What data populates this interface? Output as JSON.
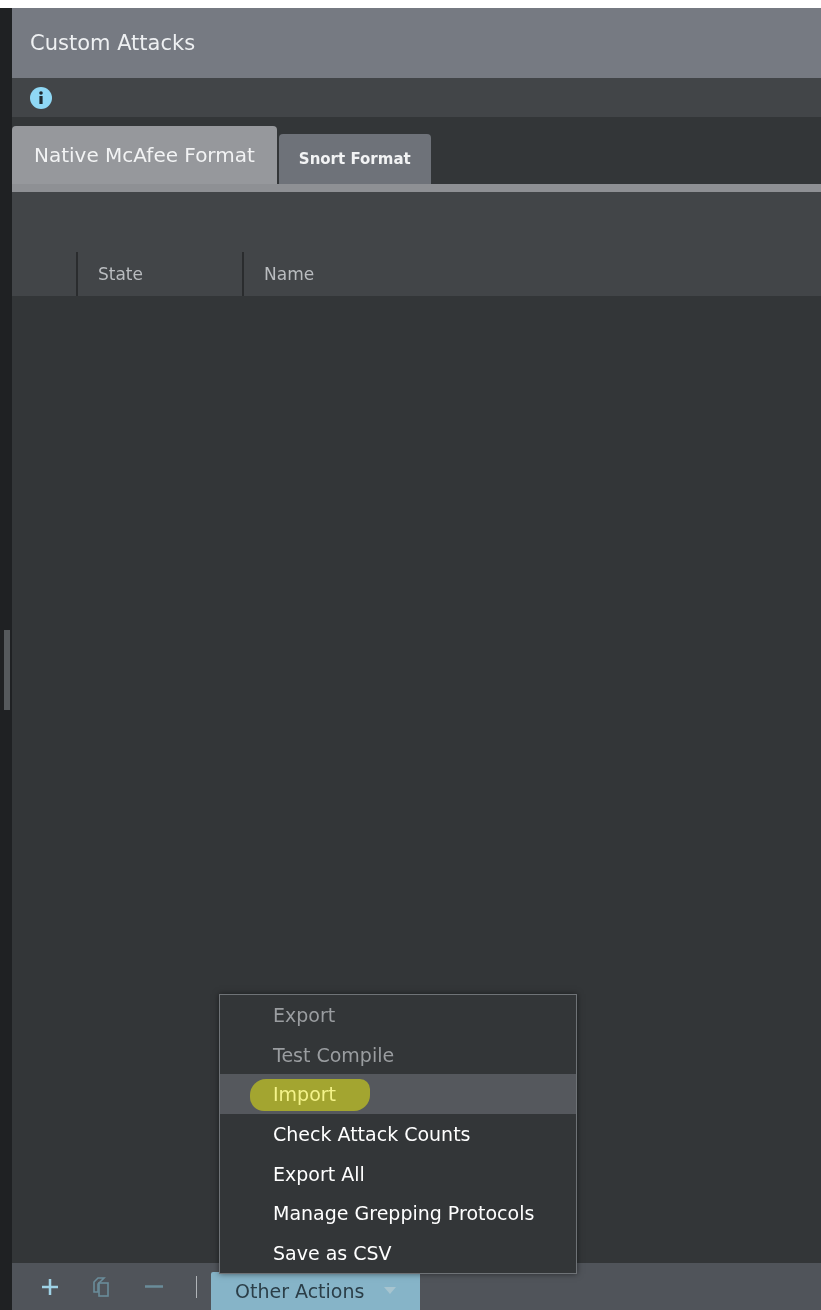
{
  "panel": {
    "title": "Custom Attacks"
  },
  "tabs": [
    {
      "label": "Native McAfee Format",
      "selected": true
    },
    {
      "label": "Snort Format",
      "selected": false
    }
  ],
  "table": {
    "columns": [
      "State",
      "Name"
    ]
  },
  "menu": {
    "items": [
      {
        "label": "Export",
        "disabled": true,
        "selected": false,
        "marked": false
      },
      {
        "label": "Test Compile",
        "disabled": true,
        "selected": false,
        "marked": false
      },
      {
        "label": "Import",
        "disabled": false,
        "selected": true,
        "marked": true
      },
      {
        "label": "Check Attack Counts",
        "disabled": false,
        "selected": false,
        "marked": false
      },
      {
        "label": "Export All",
        "disabled": false,
        "selected": false,
        "marked": false
      },
      {
        "label": "Manage Grepping Protocols",
        "disabled": false,
        "selected": false,
        "marked": false
      },
      {
        "label": "Save as CSV",
        "disabled": false,
        "selected": false,
        "marked": false
      }
    ]
  },
  "toolbar": {
    "other_actions": "Other Actions"
  }
}
